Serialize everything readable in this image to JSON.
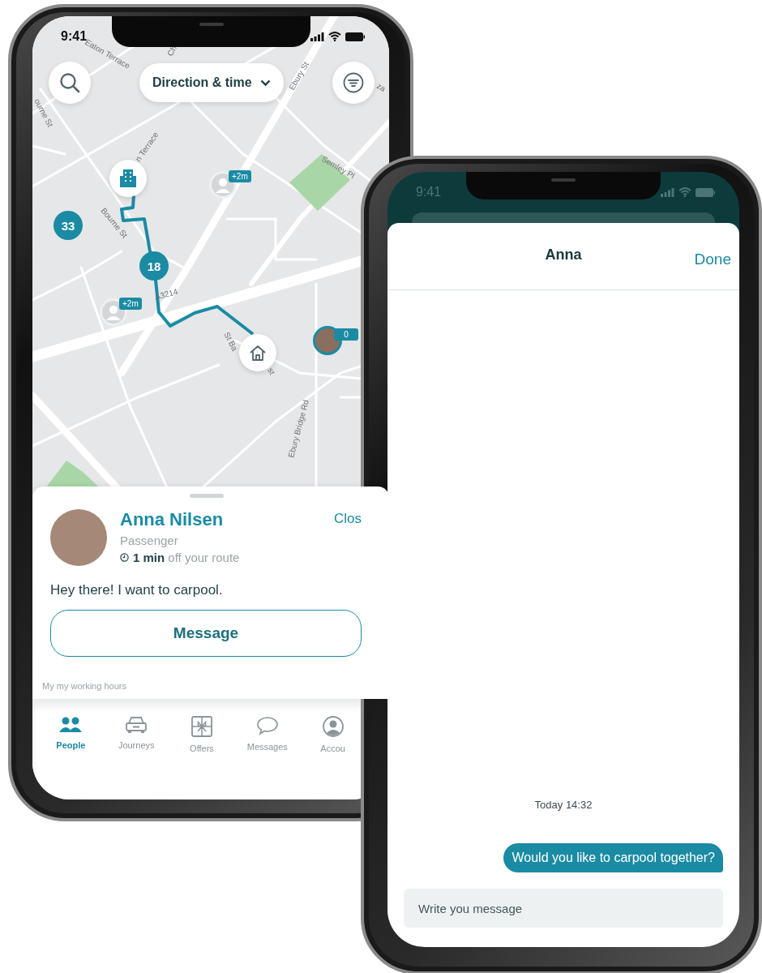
{
  "map_phone": {
    "status_bar": {
      "time": "9:41"
    },
    "direction_button": {
      "label": "Direction & time"
    },
    "street_labels": [
      {
        "text": "Eaton Terrace"
      },
      {
        "text": "Ch"
      },
      {
        "text": "Ebury St"
      },
      {
        "text": "za"
      },
      {
        "text": "ourne St"
      },
      {
        "text": "n Terrace"
      },
      {
        "text": "Semley Pl"
      },
      {
        "text": "Bourne St"
      },
      {
        "text": "A3214"
      },
      {
        "text": "St Ba"
      },
      {
        "text": "st"
      },
      {
        "text": "Ebury Bridge Rd"
      }
    ],
    "markers": [
      {
        "kind": "building"
      },
      {
        "kind": "person",
        "badge": "+2m"
      },
      {
        "kind": "cluster",
        "label": "33"
      },
      {
        "kind": "cluster",
        "label": "18"
      },
      {
        "kind": "person",
        "badge": "+2m"
      },
      {
        "kind": "home"
      },
      {
        "kind": "avatar",
        "badge": "0"
      }
    ],
    "profile_sheet": {
      "name": "Anna Nilsen",
      "role": "Passenger",
      "detour": "**1 min** off your route",
      "close": "Clos",
      "message": "Hey there! I want to carpool.",
      "message_button": "Message",
      "note": "My my working hours"
    },
    "tabs": [
      {
        "label": "People",
        "selected": true
      },
      {
        "label": "Journeys",
        "selected": false
      },
      {
        "label": "Offers",
        "selected": false
      },
      {
        "label": "Messages",
        "selected": false
      },
      {
        "label": "Accou",
        "selected": false
      }
    ]
  },
  "chat_phone": {
    "status_bar": {
      "time": "9:41"
    },
    "header": {
      "title": "Anna",
      "done": "Done"
    },
    "timestamp": "Today 14:32",
    "messages": [
      {
        "text": "Would you like to carpool together?",
        "outgoing": true
      }
    ],
    "composer": {
      "placeholder": "Write you message"
    }
  }
}
